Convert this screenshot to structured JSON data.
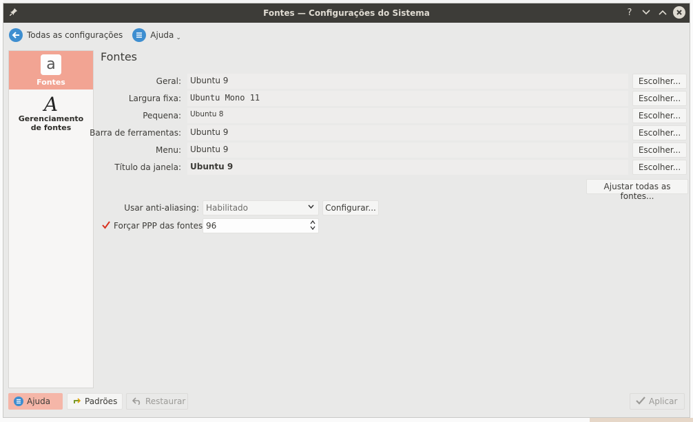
{
  "window": {
    "title": "Fontes — Configurações do Sistema",
    "controls": {
      "help": "?",
      "minimize": "⌄",
      "maximize": "⌃",
      "close": "✕"
    }
  },
  "toolbar": {
    "back_label": "Todas as configurações",
    "help_label": "Ajuda"
  },
  "sidebar": {
    "items": [
      {
        "label": "Fontes",
        "icon": "a",
        "active": true
      },
      {
        "label": "Gerenciamento de fontes",
        "icon": "A",
        "active": false
      }
    ]
  },
  "main": {
    "title": "Fontes",
    "choose_label": "Escolher...",
    "fonts": [
      {
        "label": "Geral:",
        "value": "Ubuntu 9"
      },
      {
        "label": "Largura fixa:",
        "value": "Ubuntu Mono 11"
      },
      {
        "label": "Pequena:",
        "value": "Ubuntu 8"
      },
      {
        "label": "Barra de ferramentas:",
        "value": "Ubuntu 9"
      },
      {
        "label": "Menu:",
        "value": "Ubuntu 9"
      },
      {
        "label": "Título da janela:",
        "value": "Ubuntu 9"
      }
    ],
    "adjust_all_label": "Ajustar todas as fontes...",
    "antialias": {
      "label": "Usar anti-aliasing:",
      "value": "Habilitado",
      "configure_label": "Configurar..."
    },
    "dpi": {
      "label": "Forçar PPP das fontes:",
      "checked": true,
      "value": "96"
    }
  },
  "footer": {
    "help_label": "Ajuda",
    "defaults_label": "Padrões",
    "restore_label": "Restaurar",
    "apply_label": "Aplicar"
  },
  "colors": {
    "titlebar": "#3d3c38",
    "accent": "#f2a493",
    "link_blue": "#3e8ed0"
  }
}
